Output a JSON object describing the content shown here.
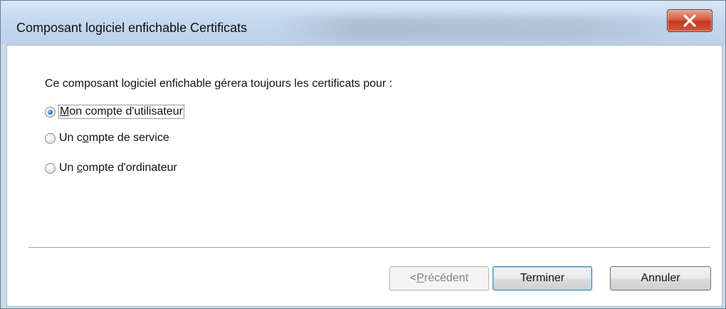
{
  "window": {
    "title": "Composant logiciel enfichable Certificats"
  },
  "dialog": {
    "heading": "Ce composant logiciel enfichable gérera toujours les certificats pour :",
    "options": [
      {
        "label_pre": "",
        "label_key": "M",
        "label_post": "on compte d'utilisateur",
        "selected": true
      },
      {
        "label_pre": "Un c",
        "label_key": "o",
        "label_post": "mpte de service",
        "selected": false
      },
      {
        "label_pre": "Un ",
        "label_key": "c",
        "label_post": "ompte d'ordinateur",
        "selected": false
      }
    ]
  },
  "buttons": {
    "back_pre": "< ",
    "back_key": "P",
    "back_post": "récédent",
    "finish": "Terminer",
    "cancel": "Annuler"
  },
  "icons": {
    "close": "close-icon"
  },
  "colors": {
    "close_button": "#c9452c",
    "radio_selected": "#2b7ad6",
    "default_button_border": "#3c7fb1"
  }
}
